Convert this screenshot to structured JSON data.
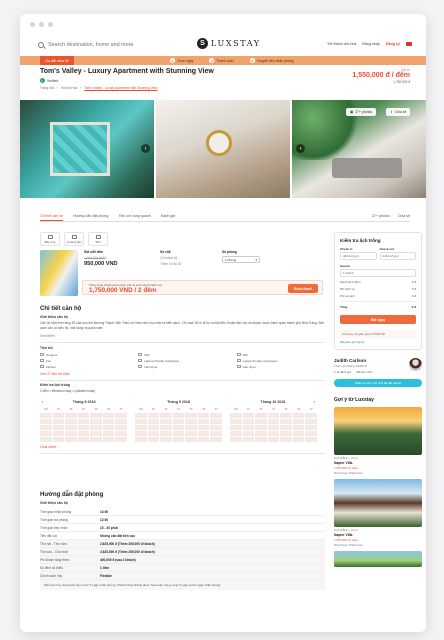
{
  "nav": {
    "search_placeholder": "Search destination, home and more",
    "logo_letter": "S",
    "logo_text": "LUXSTAY",
    "links": [
      "Trở thành chủ nhà",
      "Đăng nhập",
      "Đăng ký"
    ]
  },
  "banner": {
    "badge": "Ưu đãi mùa hè",
    "steps": [
      {
        "num": "1",
        "label": "Chọn ngày"
      },
      {
        "num": "2",
        "label": "Thanh toán"
      },
      {
        "num": "3",
        "label": "Chuyển tiền nhận phòng"
      }
    ]
  },
  "listing": {
    "title": "Tom's Valley - Luxury Apartment with Stunning View",
    "verified": "Verified",
    "breadcrumb": [
      "Trang chủ",
      "Khánh Hòa",
      "Tom's Valley - Luxury Apartment with Stunning View"
    ],
    "price_label": "Giá từ",
    "price": "1,550,000 đ / đêm",
    "price_sub": "1,750,000 đ"
  },
  "gallery": {
    "more_photos": "27+ photos",
    "share": "Chia sẻ"
  },
  "tabs": {
    "items": [
      "Chi tiết căn hộ",
      "Hướng dẫn đặt phòng",
      "Tiện ích xung quanh",
      "Đánh giá"
    ],
    "right": [
      "27+ photos",
      "Chia sẻ"
    ]
  },
  "amenities": [
    {
      "label": "Bếp ứng"
    },
    {
      "label": "1 phòng tắm"
    },
    {
      "label": "Wifi"
    }
  ],
  "booking": {
    "price_head": "Giá mỗi đêm",
    "old_price": "1,000,000 VND",
    "price": "950,000 VND",
    "guests_head": "Số chỗ",
    "guests_val": "10 khách tối",
    "guests_note": "Thêm tối đa 30",
    "rooms_head": "Số phòng",
    "rooms_select": "1 Phòng",
    "total_note": "Tổng cộng (Không bao gồm phí vệ sinh và phí dịch vụ)",
    "total": "1,750,000 VND / 2 đêm",
    "book_btn": "Book Now!"
  },
  "details": {
    "title": "Chi tiết căn hộ",
    "subtitle": "Giới thiệu căn hộ",
    "body": "Căn hộ nằm trên tầng 30 của tòa nhà Mường Thanh Viễn Triều với view nhìn trực tiếp ra biển xanh. Chỉ cách 50 m đi bộ ra bãi biển, thuận tiện cho du khách muốn tham quan thành phố Nha Trang. Bên cạnh còn có siêu thị, nhà hàng và quán cafe.",
    "more": "Xem thêm"
  },
  "utilities": {
    "title": "Tiện ích",
    "items": [
      "Hangers",
      "Wifi",
      "Wifi",
      "Iron",
      "Laptop friendly workspace",
      "Laptop friendly workspace",
      "Kitchen",
      "Hair dryer",
      "Hair dryer"
    ],
    "more": "Xem 27 tiện ích khác"
  },
  "calendar": {
    "title": "Kiểm tra lịch trống",
    "note": "2 đêm • Minimum stay • Updated today",
    "weekdays": [
      "CN",
      "T2",
      "T3",
      "T4",
      "T5",
      "T6",
      "T7"
    ],
    "months": [
      "Tháng 8 2018",
      "Tháng 9 2018",
      "Tháng 10 2018"
    ],
    "clear": "Clear dates"
  },
  "rules": {
    "title": "Hướng dẫn đặt phòng",
    "subtitle": "Giới thiệu căn hộ",
    "rows": [
      {
        "k": "Thời gian nhận phòng",
        "v": "14:00"
      },
      {
        "k": "Thời gian trả phòng",
        "v": "12:00"
      },
      {
        "k": "Thời gian tiếp nhận",
        "v": "15 - 30 phút"
      },
      {
        "k": "Tiền đặt cọc",
        "v": "Không cần đặt tiền cọc"
      },
      {
        "k": "Thứ hai - Thứ năm",
        "v": "2,625,000 đ (Thêm 250,000 đ/ khách)"
      },
      {
        "k": "Thứ sáu - Chủ nhật",
        "v": "2,625,000 đ (Thêm 250,000 đ/ khách)"
      },
      {
        "k": "Phí khách tăng thêm",
        "v": "400,000 đ (sau 2 khách)"
      },
      {
        "k": "Số đêm tối thiểu",
        "v": "1 đêm"
      }
    ],
    "policy_k": "Chính sách hủy",
    "policy_v": "Flexible",
    "policy_text": "Miễn phí hủy phòng khi hủy trước 5 ngày nhận phòng. Khách hàng không được hoàn tiền trong vòng 5 ngày trước ngày nhận phòng."
  },
  "sidebar": {
    "title": "Kiểm tra lịch trống",
    "checkin": "Check in",
    "checkout": "Check out",
    "checkin_ph": "dd/mm/yyyy",
    "checkout_ph": "dd/mm/yyyy",
    "guests_label": "Guests",
    "guests_val": "1 khách",
    "lines": [
      {
        "k": "Giá thuê 2 đêm",
        "v": "0 đ"
      },
      {
        "k": "Phí dịch vụ",
        "v": "0 đ"
      },
      {
        "k": "Phí vệ sinh",
        "v": "0 đ"
      }
    ],
    "total_k": "Tổng",
    "total_v": "0 đ",
    "cta": "Đặt ngay",
    "promo": "Sử dụng mã giảm giá LUXSTAY50",
    "promo_ok": "Mã giảm giá hợp lệ"
  },
  "host": {
    "name": "Judith Carlson",
    "meta": "Tham gia tháng 03/2018",
    "badges": [
      "1.1k đánh giá",
      "Đã xác minh"
    ],
    "message_btn": "Nhắn tin cho chủ nhà để đặt phòng"
  },
  "suggestions": {
    "title": "Gợi ý từ Luxstay",
    "items": [
      {
        "tag": "NHÀ RIÊNG • VILLA",
        "name": "Napier Villa",
        "price": "1,550,000 đ / đêm",
        "loc": "Nha Trang, Khánh Hòa"
      },
      {
        "tag": "NHÀ RIÊNG • VILLA",
        "name": "Napier Villa",
        "price": "1,550,000 đ / đêm",
        "loc": "Nha Trang, Khánh Hòa"
      }
    ]
  }
}
